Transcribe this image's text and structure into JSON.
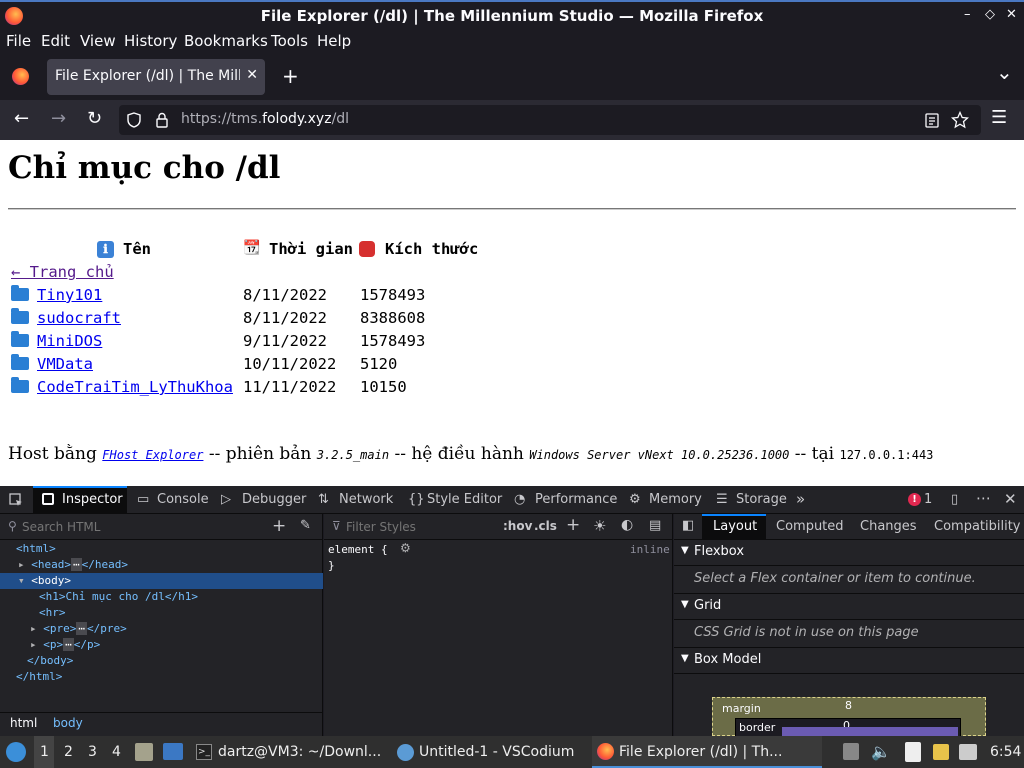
{
  "window": {
    "title": "File Explorer (/dl) | The Millennium Studio — Mozilla Firefox",
    "min": "–",
    "restore": "◇",
    "close": "✕"
  },
  "menu": {
    "items": [
      "File",
      "Edit",
      "View",
      "History",
      "Bookmarks",
      "Tools",
      "Help"
    ]
  },
  "tab": {
    "label": "File Explorer (/dl) | The Millennium Studio",
    "close": "✕",
    "new": "+",
    "list": "⌄"
  },
  "nav": {
    "back": "←",
    "forward": "→",
    "reload": "↻",
    "url_prefix": "https://tms.",
    "url_domain": "folody.xyz",
    "url_path": "/dl",
    "menu": "☰"
  },
  "page": {
    "heading": "Chỉ mục cho /dl",
    "headers": {
      "name_icon": "ℹ",
      "name": "Tên",
      "time_icon": "📆",
      "time": "Thời gian",
      "size_icon": "⛔",
      "size": "Kích thước"
    },
    "home_link": "← Trang chủ",
    "rows": [
      {
        "name": "Tiny101",
        "time": "8/11/2022",
        "size": "1578493"
      },
      {
        "name": "sudocraft",
        "time": "8/11/2022",
        "size": "8388608"
      },
      {
        "name": "MiniDOS",
        "time": "9/11/2022",
        "size": "1578493"
      },
      {
        "name": "VMData",
        "time": "10/11/2022",
        "size": "5120"
      },
      {
        "name": "CodeTraiTim_LyThuKhoa",
        "time": "11/11/2022",
        "size": "10150"
      }
    ],
    "footer": {
      "t1": "Host bằng",
      "link": "FHost Explorer",
      "t2": "-- phiên bản",
      "version": "3.2.5_main",
      "t3": "-- hệ điều hành",
      "os": "Windows Server vNext 10.0.25236.1000",
      "t4": "-- tại",
      "addr": "127.0.0.1:443"
    }
  },
  "devtools": {
    "tabs": [
      "Inspector",
      "Console",
      "Debugger",
      "Network",
      "Style Editor",
      "Performance",
      "Memory",
      "Storage"
    ],
    "error_count": "1",
    "search_placeholder": "Search HTML",
    "filter_placeholder": "Filter Styles",
    "hov": ":hov",
    "cls": ".cls",
    "tree": [
      "<html>",
      "<head>",
      "</head>",
      "<body>",
      "<h1>Chỉ mục cho /dl</h1>",
      "<hr>",
      "<pre>",
      "</pre>",
      "<p>",
      "</p>",
      "</body>",
      "</html>"
    ],
    "element_rule": "element {",
    "rule_close": "}",
    "inline": "inline",
    "breadcrumb": [
      "html",
      "body"
    ],
    "layout_tabs": [
      "Layout",
      "Computed",
      "Changes",
      "Compatibility"
    ],
    "flexbox": {
      "title": "Flexbox",
      "msg": "Select a Flex container or item to continue."
    },
    "grid": {
      "title": "Grid",
      "msg": "CSS Grid is not in use on this page"
    },
    "box": {
      "title": "Box Model",
      "margin": "margin",
      "margin_val": "8",
      "border": "border",
      "border_val": "0"
    }
  },
  "taskbar": {
    "workspaces": [
      "1",
      "2",
      "3",
      "4"
    ],
    "apps": [
      "dartz@VM3: ~/Downl...",
      "Untitled-1 - VSCodium",
      "File Explorer (/dl) | Th..."
    ],
    "clock": "6:54"
  }
}
